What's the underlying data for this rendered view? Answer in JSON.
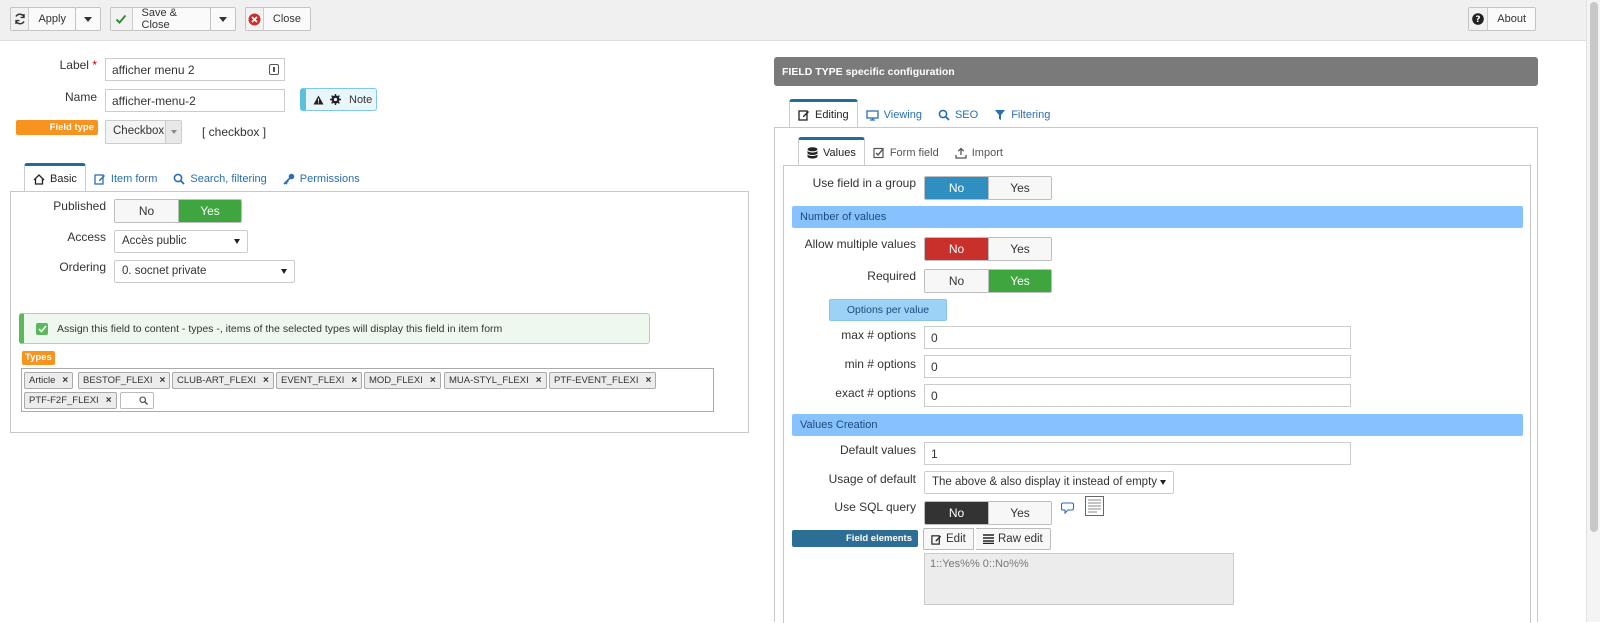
{
  "toolbar": {
    "apply": "Apply",
    "save_close": "Save & Close",
    "close": "Close",
    "about": "About"
  },
  "form": {
    "label_label": "Label",
    "required_mark": "*",
    "label_value": "afficher menu 2",
    "name_label": "Name",
    "name_value": "afficher-menu-2",
    "note_button": "Note",
    "field_type_label": "Field type",
    "field_type_value": "Checkbox",
    "field_type_code": "[ checkbox ]"
  },
  "left_tabs": [
    "Basic",
    "Item form",
    "Search, filtering",
    "Permissions"
  ],
  "basic": {
    "published_label": "Published",
    "no": "No",
    "yes": "Yes",
    "access_label": "Access",
    "access_value": "Accès public",
    "ordering_label": "Ordering",
    "ordering_value": "0. socnet private",
    "assign_text": "Assign this field to content - types -, items of the selected types will display this field in item form",
    "types_label": "Types",
    "types": [
      "Article",
      "BESTOF_FLEXI",
      "CLUB-ART_FLEXI",
      "EVENT_FLEXI",
      "MOD_FLEXI",
      "MUA-STYL_FLEXI",
      "PTF-EVENT_FLEXI",
      "PTF-F2F_FLEXI"
    ]
  },
  "right": {
    "header": "FIELD TYPE specific configuration",
    "tabs": [
      "Editing",
      "Viewing",
      "SEO",
      "Filtering"
    ],
    "subtabs": [
      "Values",
      "Form field",
      "Import"
    ],
    "use_group_label": "Use field in a group",
    "no": "No",
    "yes": "Yes",
    "section_number": "Number of values",
    "allow_multiple_label": "Allow multiple values",
    "required_label": "Required",
    "options_per_value": "Options per value",
    "max_label": "max # options",
    "max_value": "0",
    "min_label": "min # options",
    "min_value": "0",
    "exact_label": "exact # options",
    "exact_value": "0",
    "section_creation": "Values Creation",
    "default_label": "Default values",
    "default_value": "1",
    "usage_label": "Usage of default",
    "usage_value": "The above & also display it instead of empty",
    "sql_label": "Use SQL query",
    "field_elements": "Field elements",
    "edit": "Edit",
    "raw_edit": "Raw edit",
    "elements_value": "1::Yes%% 0::No%%"
  },
  "colors": {
    "blue_active": "#2f8fc0",
    "green_active": "#3fa63f",
    "red_active": "#c9302c",
    "dark_active": "#333333",
    "orange": "#f7931e",
    "section_blue": "#87c2ff",
    "header_gray": "#7a7a7a"
  }
}
